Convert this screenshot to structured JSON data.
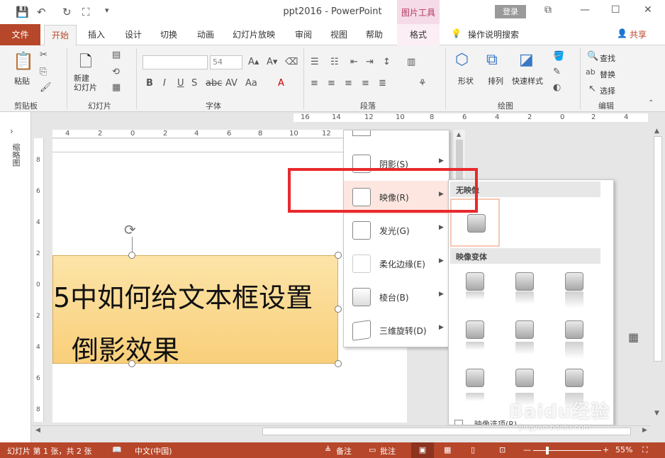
{
  "window": {
    "title": "ppt2016 - PowerPoint",
    "login_label": "登录",
    "picture_tools_label": "图片工具"
  },
  "ribbon": {
    "tabs": [
      "文件",
      "开始",
      "插入",
      "设计",
      "切换",
      "动画",
      "幻灯片放映",
      "审阅",
      "视图",
      "帮助",
      "格式"
    ],
    "search_tell": "操作说明搜索",
    "share_label": "共享",
    "groups": {
      "clipboard": {
        "label": "剪贴板",
        "paste": "粘贴"
      },
      "slides": {
        "label": "幻灯片",
        "new_slide": "新建\n幻灯片"
      },
      "font": {
        "label": "字体",
        "font_name": "",
        "font_size": "54"
      },
      "paragraph": {
        "label": "段落"
      },
      "drawing": {
        "label": "绘图",
        "shape": "形状",
        "arrange": "排列",
        "quick_style": "快速样式"
      },
      "editing": {
        "label": "编辑",
        "find": "查找",
        "replace": "替换",
        "select": "选择"
      }
    }
  },
  "thumbnail_pane": {
    "label": "缩略图"
  },
  "slide": {
    "text_line1": "5中如何给文本框设置",
    "text_line2": "倒影效果"
  },
  "effect_menu": {
    "items": [
      {
        "label": "阴影(S)"
      },
      {
        "label": "映像(R)"
      },
      {
        "label": "发光(G)"
      },
      {
        "label": "柔化边缘(E)"
      },
      {
        "label": "棱台(B)"
      },
      {
        "label": "三维旋转(D)"
      }
    ]
  },
  "reflection_menu": {
    "no_reflection_header": "无映像",
    "variations_header": "映像变体",
    "options_label": "映像选项(R)..."
  },
  "status_bar": {
    "slide_info": "幻灯片 第 1 张，共 2 张",
    "language": "中文(中国)",
    "notes": "备注",
    "comments": "批注",
    "zoom": "55%"
  },
  "watermark": {
    "brand": "Baidu经验",
    "url": "jingyan.baidu.com"
  },
  "colors": {
    "accent": "#b7472a",
    "highlight": "#e8292c",
    "textbox_fill": "#f9cf7a"
  }
}
